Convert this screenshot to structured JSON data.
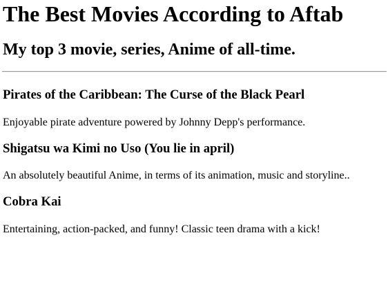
{
  "header": {
    "title": "The Best Movies According to Aftab",
    "subtitle": "My top 3 movie, series, Anime of all-time."
  },
  "movies": [
    {
      "title": "Pirates of the Caribbean: The Curse of the Black Pearl",
      "description": "Enjoyable pirate adventure powered by Johnny Depp's performance."
    },
    {
      "title": "Shigatsu wa Kimi no Uso (You lie in april)",
      "description": "An absolutely beautiful Anime, in terms of its animation, music and storyline.."
    },
    {
      "title": "Cobra Kai",
      "description": "Entertaining, action-packed, and funny! Classic teen drama with a kick!"
    }
  ]
}
